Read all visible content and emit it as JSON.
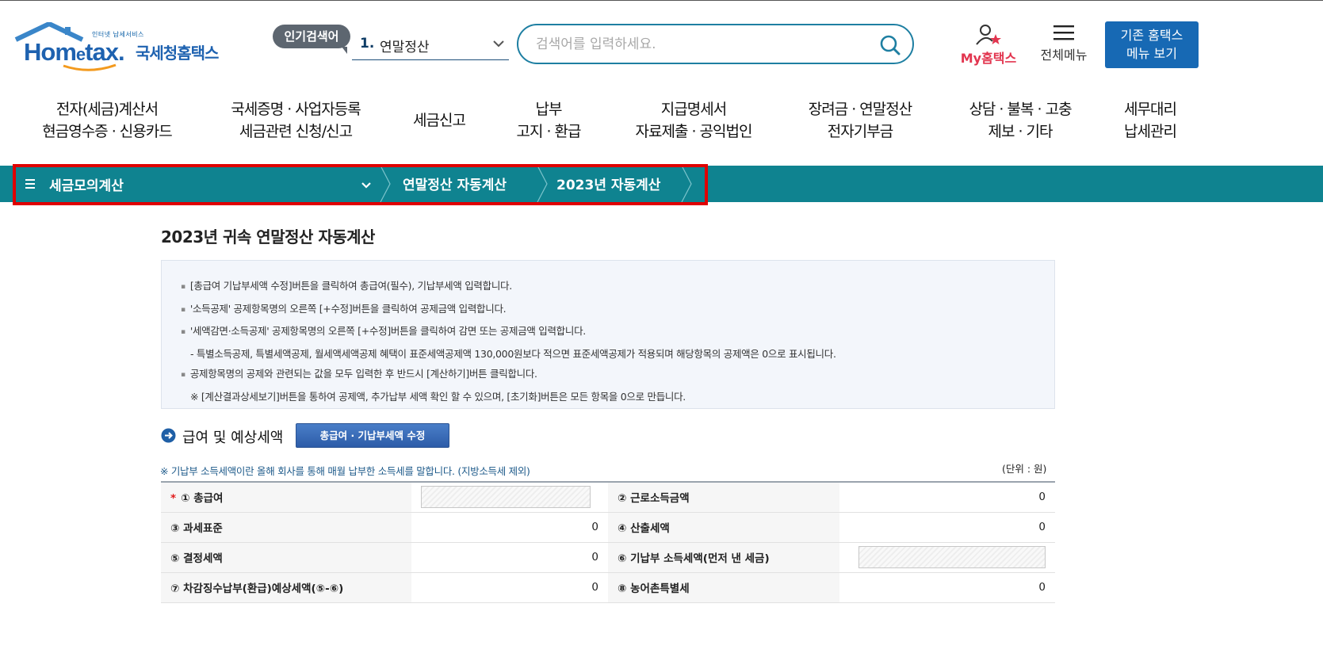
{
  "header": {
    "logo_tagline": "인터넷 납세서비스",
    "logo_brand": "Hom",
    "logo_brand_e": "e",
    "logo_brand_tail": "tax.",
    "logo_korean": "국세청홈택스",
    "popular_badge": "인기검색어",
    "popular_rank": "1.",
    "popular_term": "연말정산",
    "search_placeholder": "검색어를 입력하세요.",
    "my_hometax": "My홈택스",
    "all_menu": "전체메뉴",
    "old_menu_line1": "기존 홈택스",
    "old_menu_line2": "메뉴 보기"
  },
  "nav": [
    {
      "line1": "전자(세금)계산서",
      "line2": "현금영수증 · 신용카드"
    },
    {
      "line1": "국세증명 · 사업자등록",
      "line2": "세금관련 신청/신고"
    },
    {
      "line1": "세금신고",
      "line2": ""
    },
    {
      "line1": "납부",
      "line2": "고지 · 환급"
    },
    {
      "line1": "지급명세서",
      "line2": "자료제출 · 공익법인"
    },
    {
      "line1": "장려금 · 연말정산",
      "line2": "전자기부금"
    },
    {
      "line1": "상담 · 불복 · 고충",
      "line2": "제보 · 기타"
    },
    {
      "line1": "세무대리",
      "line2": "납세관리"
    }
  ],
  "breadcrumb": {
    "menu": "세금모의계산",
    "level2": "연말정산 자동계산",
    "level3": "2023년 자동계산"
  },
  "page": {
    "title": "2023년 귀속 연말정산 자동계산",
    "notices": [
      "[총급여 기납부세액 수정]버튼을 클릭하여 총급여(필수), 기납부세액 입력합니다.",
      "'소득공제' 공제항목명의 오른쪽 [+수정]버튼을 클릭하여 공제금액 입력합니다.",
      "'세액감면·소득공제' 공제항목명의 오른쪽 [+수정]버튼을 클릭하여 감면 또는 공제금액 입력합니다.",
      "- 특별소득공제, 특별세액공제, 월세액세액공제 혜택이 표준세액공제액 130,000원보다 적으면 표준세액공제가 적용되며 해당항목의 공제액은 0으로 표시됩니다.",
      "공제항목명의 공제와 관련되는 값을 모두 입력한 후 반드시 [계산하기]버튼 클릭합니다.",
      "※ [계산결과상세보기]버튼을 통하여 공제액, 추가납부 세액 확인 할 수 있으며, [초기화]버튼은 모든 항목을 0으로 만듭니다."
    ],
    "section_title": "급여 및 예상세액",
    "edit_button": "총급여 · 기납부세액 수정",
    "note": "※ 기납부 소득세액이란 올해 회사를 통해 매월 납부한 소득세를 말합니다. (지방소득세 제외)",
    "unit": "(단위 : 원)"
  },
  "table": {
    "required_mark": "*",
    "rows": [
      {
        "l_label": "① 총급여",
        "l_value": "",
        "r_label": "② 근로소득금액",
        "r_value": "0"
      },
      {
        "l_label": "③ 과세표준",
        "l_value": "0",
        "r_label": "④ 산출세액",
        "r_value": "0"
      },
      {
        "l_label": "⑤ 결정세액",
        "l_value": "0",
        "r_label": "⑥ 기납부 소득세액(먼저 낸 세금)",
        "r_value": ""
      },
      {
        "l_label": "⑦ 차감징수납부(환급)예상세액(⑤-⑥)",
        "l_value": "0",
        "r_label": "⑧ 농어촌특별세",
        "r_value": "0"
      }
    ]
  },
  "colors": {
    "brand_blue": "#1e62b0",
    "breadcrumb_teal": "#0f8390",
    "highlight_red": "#e00000",
    "my_hometax_red": "#e2354f",
    "button_blue": "#1769b4"
  }
}
